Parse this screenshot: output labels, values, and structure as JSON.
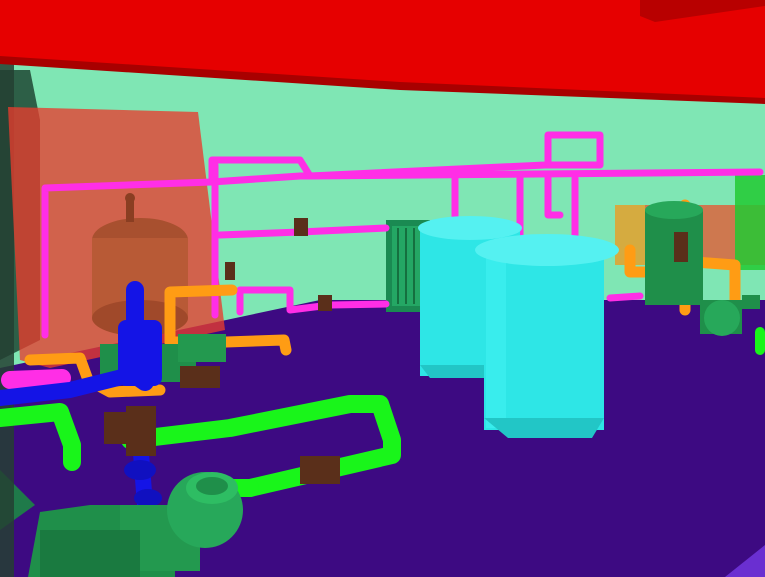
{
  "scene": {
    "colors": {
      "wall": "#7fe6b4",
      "ceiling": "#e60000",
      "floor": "#3d0a82",
      "pipe_magenta": "#ff2ee6",
      "pipe_green": "#19f51a",
      "pipe_blue": "#1414e6",
      "pipe_orange": "#ff9c14",
      "valve_brown": "#5a2f1a",
      "tank_cyan": "#2ee6e6",
      "tank_brown": "#c85a3c",
      "pump_green": "#1f8f4a",
      "panel_red": "#e83c2e"
    },
    "objects": [
      "ceiling-beam",
      "rear-wall",
      "floor",
      "red-panel",
      "pressure-vessel",
      "cyan-tank-left",
      "cyan-tank-right",
      "plate-heat-exchanger",
      "magenta-pipe-network",
      "green-pipe-loop",
      "blue-vertical-pipe",
      "orange-pipe-run",
      "gate-valves",
      "centrifugal-pump-front",
      "pump-mid-left",
      "filter-vessel-right",
      "pump-right"
    ]
  }
}
